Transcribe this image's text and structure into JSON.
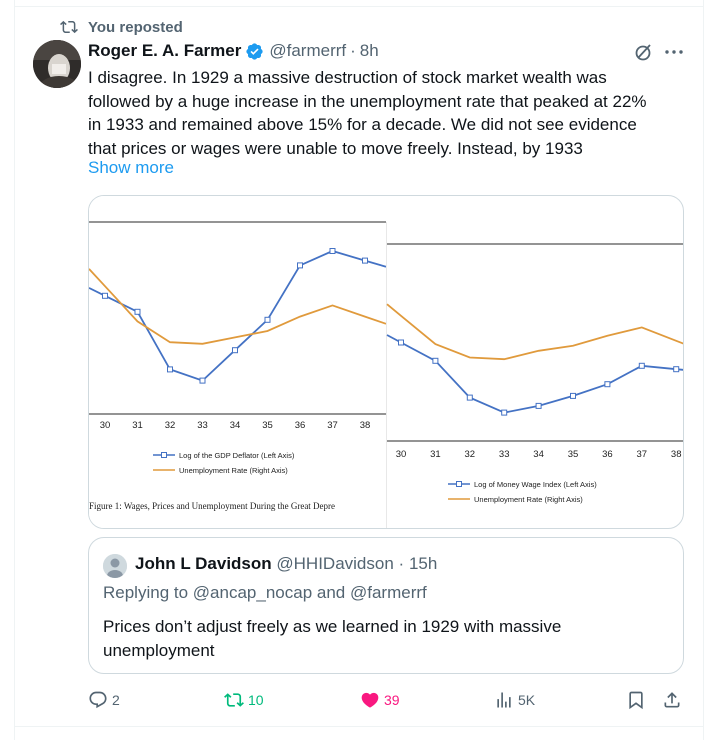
{
  "repost": {
    "label": "You reposted",
    "icon": "repost-icon"
  },
  "author": {
    "name": "Roger E. A. Farmer",
    "handle": "@farmerrf",
    "separator": "·",
    "time": "8h",
    "verified": true
  },
  "tweet": {
    "lines": [
      "I disagree. In 1929 a massive destruction of stock market wealth was",
      "followed by a huge increase in the unemployment rate that peaked at 22%",
      "in 1933 and remained above 15% for a decade.  We did not see evidence",
      "that prices or wages were unable to move freely. Instead, by 1933"
    ],
    "show_more": "Show more"
  },
  "media": {
    "left_chart": {
      "ticks": [
        "30",
        "31",
        "32",
        "33",
        "34",
        "35",
        "36",
        "37",
        "38"
      ],
      "legend": [
        "Log of the GDP Deflator (Left Axis)",
        "Unemployment Rate (Right Axis)"
      ],
      "caption": "Figure 1: Wages, Prices and Unemployment During the Great Depre"
    },
    "right_chart": {
      "ticks": [
        "30",
        "31",
        "32",
        "33",
        "34",
        "35",
        "36",
        "37",
        "38"
      ],
      "legend": [
        "Log of Money Wage Index (Left Axis)",
        "Unemployment Rate (Right Axis)"
      ]
    }
  },
  "chart_data": [
    {
      "type": "line",
      "categories": [
        "30",
        "31",
        "32",
        "33",
        "34",
        "35",
        "36",
        "37",
        "38"
      ],
      "series": [
        {
          "name": "Log of the GDP Deflator (Left Axis)",
          "values": [
            0.72,
            0.62,
            0.26,
            0.19,
            0.38,
            0.57,
            0.91,
            1.0,
            0.94
          ]
        },
        {
          "name": "Unemployment Rate (Right Axis)",
          "values": [
            0.78,
            0.56,
            0.43,
            0.42,
            0.46,
            0.5,
            0.59,
            0.66,
            0.59
          ]
        }
      ],
      "colors": [
        "#4472c4",
        "#e09a3c"
      ]
    },
    {
      "type": "line",
      "categories": [
        "30",
        "31",
        "32",
        "33",
        "34",
        "35",
        "36",
        "37",
        "38"
      ],
      "series": [
        {
          "name": "Log of Money Wage Index (Left Axis)",
          "values": [
            0.59,
            0.48,
            0.26,
            0.17,
            0.21,
            0.27,
            0.34,
            0.45,
            0.43
          ]
        },
        {
          "name": "Unemployment Rate (Right Axis)",
          "values": [
            0.75,
            0.58,
            0.5,
            0.49,
            0.54,
            0.57,
            0.63,
            0.68,
            0.6
          ]
        }
      ],
      "colors": [
        "#4472c4",
        "#e09a3c"
      ]
    }
  ],
  "quote": {
    "name": "John L Davidson",
    "handle": "@HHIDavidson",
    "separator": "·",
    "time": "15h",
    "replying_prefix": "Replying to",
    "replying_1": "@ancap_nocap",
    "replying_and": "and",
    "replying_2": "@farmerrf",
    "text_lines": [
      "Prices don’t adjust freely as we learned in 1929 with massive",
      "unemployment"
    ]
  },
  "actions": {
    "replies": "2",
    "reposts": "10",
    "likes": "39",
    "views": "5K"
  },
  "colors": {
    "accent": "#1d9bf0",
    "repost": "#00ba7c",
    "like": "#f91880",
    "muted": "#536471"
  }
}
